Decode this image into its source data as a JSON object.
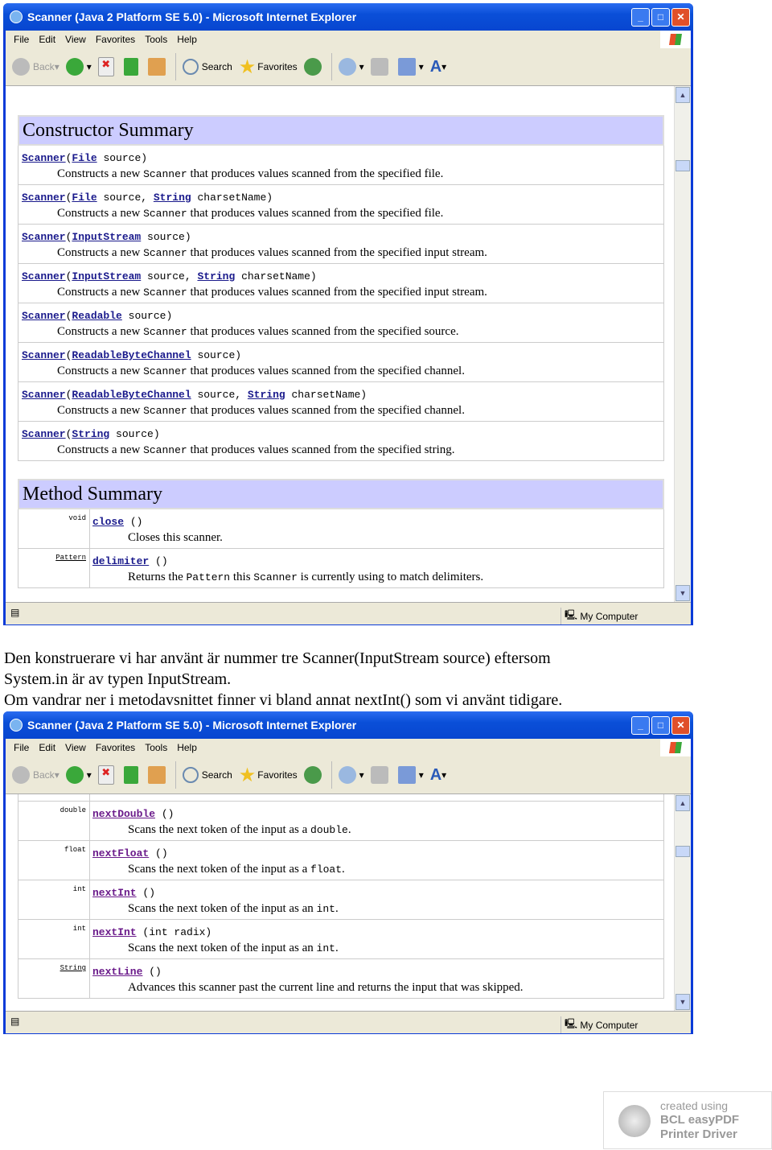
{
  "window": {
    "title": "Scanner (Java 2 Platform SE 5.0) - Microsoft Internet Explorer",
    "menu": [
      "File",
      "Edit",
      "View",
      "Favorites",
      "Tools",
      "Help"
    ],
    "toolbar": {
      "back": "Back",
      "search": "Search",
      "favorites": "Favorites"
    },
    "status": "My Computer"
  },
  "screen1": {
    "constructor_header": "Constructor Summary",
    "constructors": [
      {
        "sig": [
          [
            "Scanner",
            1
          ],
          [
            "(",
            0
          ],
          [
            "File",
            1
          ],
          [
            " source)",
            0
          ]
        ],
        "desc": [
          [
            "Constructs a new ",
            0
          ],
          [
            "Scanner",
            1
          ],
          [
            " that produces values scanned from the specified file.",
            0
          ]
        ]
      },
      {
        "sig": [
          [
            "Scanner",
            1
          ],
          [
            "(",
            0
          ],
          [
            "File",
            1
          ],
          [
            " source, ",
            0
          ],
          [
            "String",
            1
          ],
          [
            " charsetName)",
            0
          ]
        ],
        "desc": [
          [
            "Constructs a new ",
            0
          ],
          [
            "Scanner",
            1
          ],
          [
            " that produces values scanned from the specified file.",
            0
          ]
        ]
      },
      {
        "sig": [
          [
            "Scanner",
            1
          ],
          [
            "(",
            0
          ],
          [
            "InputStream",
            1
          ],
          [
            " source)",
            0
          ]
        ],
        "desc": [
          [
            "Constructs a new ",
            0
          ],
          [
            "Scanner",
            1
          ],
          [
            " that produces values scanned from the specified input stream.",
            0
          ]
        ]
      },
      {
        "sig": [
          [
            "Scanner",
            1
          ],
          [
            "(",
            0
          ],
          [
            "InputStream",
            1
          ],
          [
            " source, ",
            0
          ],
          [
            "String",
            1
          ],
          [
            " charsetName)",
            0
          ]
        ],
        "desc": [
          [
            "Constructs a new ",
            0
          ],
          [
            "Scanner",
            1
          ],
          [
            " that produces values scanned from the specified input stream.",
            0
          ]
        ]
      },
      {
        "sig": [
          [
            "Scanner",
            1
          ],
          [
            "(",
            0
          ],
          [
            "Readable",
            1
          ],
          [
            " source)",
            0
          ]
        ],
        "desc": [
          [
            "Constructs a new ",
            0
          ],
          [
            "Scanner",
            1
          ],
          [
            " that produces values scanned from the specified source.",
            0
          ]
        ]
      },
      {
        "sig": [
          [
            "Scanner",
            1
          ],
          [
            "(",
            0
          ],
          [
            "ReadableByteChannel",
            1
          ],
          [
            " source)",
            0
          ]
        ],
        "desc": [
          [
            "Constructs a new ",
            0
          ],
          [
            "Scanner",
            1
          ],
          [
            " that produces values scanned from the specified channel.",
            0
          ]
        ]
      },
      {
        "sig": [
          [
            "Scanner",
            1
          ],
          [
            "(",
            0
          ],
          [
            "ReadableByteChannel",
            1
          ],
          [
            " source, ",
            0
          ],
          [
            "String",
            1
          ],
          [
            " charsetName)",
            0
          ]
        ],
        "desc": [
          [
            "Constructs a new ",
            0
          ],
          [
            "Scanner",
            1
          ],
          [
            " that produces values scanned from the specified channel.",
            0
          ]
        ]
      },
      {
        "sig": [
          [
            "Scanner",
            1
          ],
          [
            "(",
            0
          ],
          [
            "String",
            1
          ],
          [
            " source)",
            0
          ]
        ],
        "desc": [
          [
            "Constructs a new ",
            0
          ],
          [
            "Scanner",
            1
          ],
          [
            " that produces values scanned from the specified string.",
            0
          ]
        ]
      }
    ],
    "method_header": "Method Summary",
    "methods": [
      {
        "type": "void",
        "typeLink": false,
        "sig": [
          [
            "close",
            1
          ],
          [
            " ()",
            0
          ]
        ],
        "desc": [
          [
            "Closes this scanner.",
            0
          ]
        ]
      },
      {
        "type": "Pattern",
        "typeLink": true,
        "sig": [
          [
            "delimiter",
            1
          ],
          [
            " ()",
            0
          ]
        ],
        "desc": [
          [
            "Returns the ",
            0
          ],
          [
            "Pattern",
            1
          ],
          [
            " this ",
            0
          ],
          [
            "Scanner",
            1
          ],
          [
            " is currently using to match delimiters.",
            0
          ]
        ]
      }
    ]
  },
  "paragraph": [
    "Den konstruerare vi har använt är nummer tre Scanner(InputStream source) eftersom",
    "System.in är av typen InputStream.",
    "Om vandrar ner i metodavsnittet finner vi bland annat nextInt() som vi använt tidigare."
  ],
  "screen2": {
    "methods": [
      {
        "type": "double",
        "typeLink": false,
        "sig": [
          [
            "nextDouble",
            1
          ],
          [
            " ()",
            0
          ]
        ],
        "desc": [
          [
            "Scans the next token of the input as a ",
            0
          ],
          [
            "double",
            1
          ],
          [
            ".",
            0
          ]
        ]
      },
      {
        "type": "float",
        "typeLink": false,
        "sig": [
          [
            "nextFloat",
            1
          ],
          [
            " ()",
            0
          ]
        ],
        "desc": [
          [
            "Scans the next token of the input as a ",
            0
          ],
          [
            "float",
            1
          ],
          [
            ".",
            0
          ]
        ]
      },
      {
        "type": "int",
        "typeLink": false,
        "sig": [
          [
            "nextInt",
            1
          ],
          [
            " ()",
            0
          ]
        ],
        "desc": [
          [
            "Scans the next token of the input as an ",
            0
          ],
          [
            "int",
            1
          ],
          [
            ".",
            0
          ]
        ]
      },
      {
        "type": "int",
        "typeLink": false,
        "sig": [
          [
            "nextInt",
            1
          ],
          [
            " (int radix)",
            0
          ]
        ],
        "desc": [
          [
            "Scans the next token of the input as an ",
            0
          ],
          [
            "int",
            1
          ],
          [
            ".",
            0
          ]
        ]
      },
      {
        "type": "String",
        "typeLink": true,
        "sig": [
          [
            "nextLine",
            1
          ],
          [
            " ()",
            0
          ]
        ],
        "desc": [
          [
            "Advances this scanner past the current line and returns the input that was skipped.",
            0
          ]
        ]
      }
    ]
  },
  "watermark": {
    "line1": "created using",
    "line2": "BCL easyPDF",
    "line3": "Printer Driver"
  },
  "colors": {
    "table_header": "#ccccff",
    "link": "#1a1a8c",
    "visited_link": "#6a1a8a",
    "titlebar": "#0a4fd8"
  }
}
